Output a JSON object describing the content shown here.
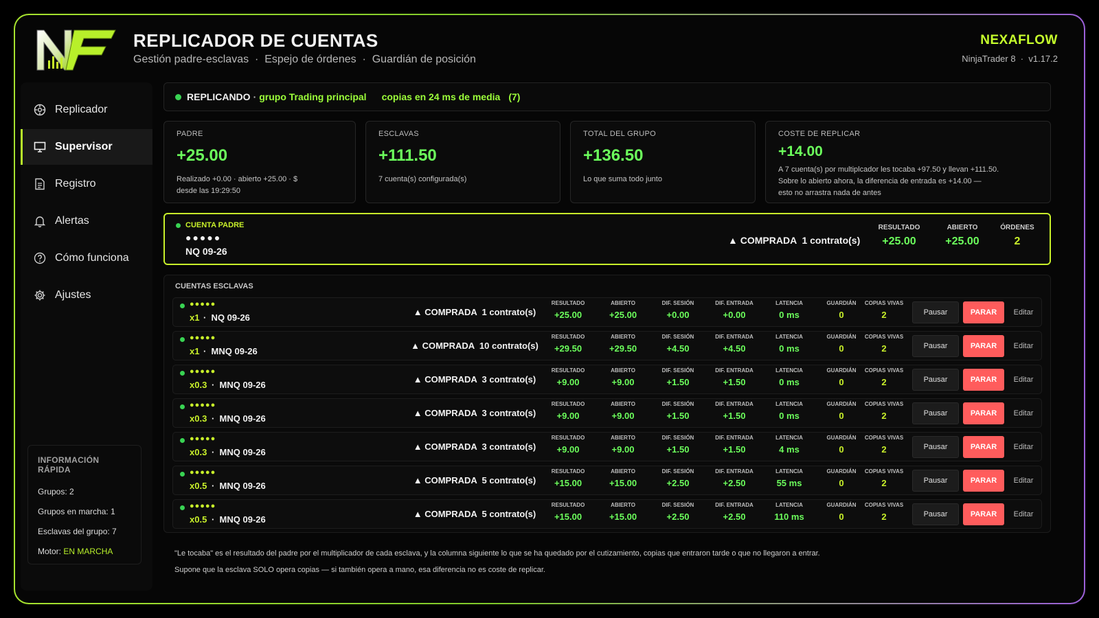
{
  "header": {
    "title": "REPLICADOR DE CUENTAS",
    "subtitle": "Gestión padre-esclavas  ·  Espejo de órdenes  ·  Guardián de posición",
    "brand": "NEXAFLOW",
    "version": "NinjaTrader 8  ·  v1.17.2"
  },
  "sidebar": {
    "items": [
      {
        "label": "Replicador",
        "icon": "replicator-icon"
      },
      {
        "label": "Supervisor",
        "icon": "monitor-icon"
      },
      {
        "label": "Registro",
        "icon": "log-icon"
      },
      {
        "label": "Alertas",
        "icon": "bell-icon"
      },
      {
        "label": "Cómo funciona",
        "icon": "help-icon"
      },
      {
        "label": "Ajustes",
        "icon": "gear-icon"
      }
    ],
    "active_index": 1
  },
  "quick_info": {
    "title": "INFORMACIÓN RÁPIDA",
    "groups": "Grupos: 2",
    "groups_running": "Grupos en marcha: 1",
    "group_slaves": "Esclavas del grupo: 7",
    "engine_label": "Motor:",
    "engine_value": "EN MARCHA"
  },
  "status": {
    "state": "REPLICANDO",
    "sep": "·",
    "group": "grupo Trading principal",
    "latency": "copias en 24 ms de media",
    "count": "(7)"
  },
  "cards": [
    {
      "label": "PADRE",
      "value": "+25.00",
      "note1": "Realizado +0.00  ·  abierto +25.00  ·  $",
      "note2": "desde las 19:29:50"
    },
    {
      "label": "ESCLAVAS",
      "value": "+111.50",
      "note1": "7 cuenta(s) configurada(s)",
      "note2": ""
    },
    {
      "label": "TOTAL DEL GRUPO",
      "value": "+136.50",
      "note1": "Lo que suma todo junto",
      "note2": ""
    },
    {
      "label": "COSTE DE REPLICAR",
      "value": "+14.00",
      "note1": "A 7 cuenta(s) por multiplcador les tocaba +97.50 y llevan +111.50.",
      "note2": "Sobre lo abierto ahora, la diferencia de entrada es +14.00 —",
      "note3": "esto no arrastra nada de antes"
    }
  ],
  "parent": {
    "label": "CUENTA PADRE",
    "masked": "●●●●●",
    "symbol": "NQ 09-26",
    "position": "▲ COMPRADA  1 contrato(s)",
    "stats": [
      {
        "label": "RESULTADO",
        "value": "+25.00"
      },
      {
        "label": "ABIERTO",
        "value": "+25.00"
      },
      {
        "label": "ÓRDENES",
        "value": "2"
      }
    ]
  },
  "slaves": {
    "title": "CUENTAS ESCLAVAS",
    "columns": [
      "RESULTADO",
      "ABIERTO",
      "DIF. SESIÓN",
      "DIF. ENTRADA",
      "LATENCIA",
      "GUARDIÁN",
      "COPIAS VIVAS"
    ],
    "buttons": {
      "pause": "Pausar",
      "stop": "PARAR",
      "edit": "Editar"
    },
    "rows": [
      {
        "masked": "●●●●●",
        "mult": "x1",
        "symbol": "·  NQ 09-26",
        "position": "▲ COMPRADA  1 contrato(s)",
        "values": [
          "+25.00",
          "+25.00",
          "+0.00",
          "+0.00",
          "0 ms",
          "0",
          "2"
        ]
      },
      {
        "masked": "●●●●●",
        "mult": "x1",
        "symbol": "·  MNQ 09-26",
        "position": "▲ COMPRADA  10 contrato(s)",
        "values": [
          "+29.50",
          "+29.50",
          "+4.50",
          "+4.50",
          "0 ms",
          "0",
          "2"
        ]
      },
      {
        "masked": "●●●●●",
        "mult": "x0.3",
        "symbol": "·  MNQ 09-26",
        "position": "▲ COMPRADA  3 contrato(s)",
        "values": [
          "+9.00",
          "+9.00",
          "+1.50",
          "+1.50",
          "0 ms",
          "0",
          "2"
        ]
      },
      {
        "masked": "●●●●●",
        "mult": "x0.3",
        "symbol": "·  MNQ 09-26",
        "position": "▲ COMPRADA  3 contrato(s)",
        "values": [
          "+9.00",
          "+9.00",
          "+1.50",
          "+1.50",
          "0 ms",
          "0",
          "2"
        ]
      },
      {
        "masked": "●●●●●",
        "mult": "x0.3",
        "symbol": "·  MNQ 09-26",
        "position": "▲ COMPRADA  3 contrato(s)",
        "values": [
          "+9.00",
          "+9.00",
          "+1.50",
          "+1.50",
          "4 ms",
          "0",
          "2"
        ]
      },
      {
        "masked": "●●●●●",
        "mult": "x0.5",
        "symbol": "·  MNQ 09-26",
        "position": "▲ COMPRADA  5 contrato(s)",
        "values": [
          "+15.00",
          "+15.00",
          "+2.50",
          "+2.50",
          "55 ms",
          "0",
          "2"
        ]
      },
      {
        "masked": "●●●●●",
        "mult": "x0.5",
        "symbol": "·  MNQ 09-26",
        "position": "▲ COMPRADA  5 contrato(s)",
        "values": [
          "+15.00",
          "+15.00",
          "+2.50",
          "+2.50",
          "110 ms",
          "0",
          "2"
        ]
      }
    ]
  },
  "footnotes": [
    "\"Le tocaba\" es el resultado del padre por el multiplicador de cada esclava, y la columna siguiente lo que se ha quedado por el cutizamiento, copias que entraron tarde o que no llegaron a entrar.",
    "Supone que la esclava SOLO opera copias — si también opera a mano, esa diferencia no es coste de replicar."
  ],
  "colors": {
    "accent": "#c8f02a",
    "positive": "#6cff5c",
    "stop": "#ff5c5c",
    "status_dot": "#39d353"
  }
}
